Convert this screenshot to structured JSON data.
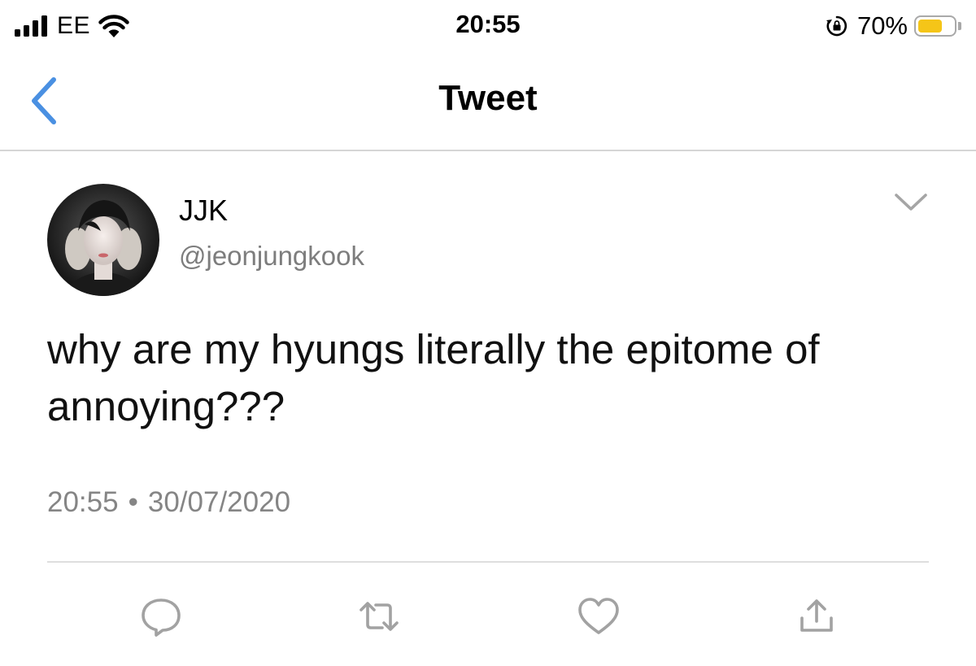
{
  "status_bar": {
    "carrier": "EE",
    "time": "20:55",
    "battery_percent": "70%",
    "battery_level": 0.7,
    "battery_color": "#f5c518",
    "icons": [
      "signal-bars-icon",
      "wifi-icon",
      "rotation-lock-icon",
      "battery-icon"
    ]
  },
  "nav": {
    "title": "Tweet",
    "back_icon": "chevron-left-icon",
    "accent_color": "#4a90e2"
  },
  "tweet": {
    "display_name": "JJK",
    "handle": "@jeonjungkook",
    "text": "why are my hyungs literally the epitome of annoying???",
    "time": "20:55",
    "separator": "•",
    "date": "30/07/2020",
    "menu_icon": "chevron-down-icon"
  },
  "actions": {
    "icons": [
      "reply-icon",
      "retweet-icon",
      "like-icon",
      "share-icon"
    ]
  }
}
